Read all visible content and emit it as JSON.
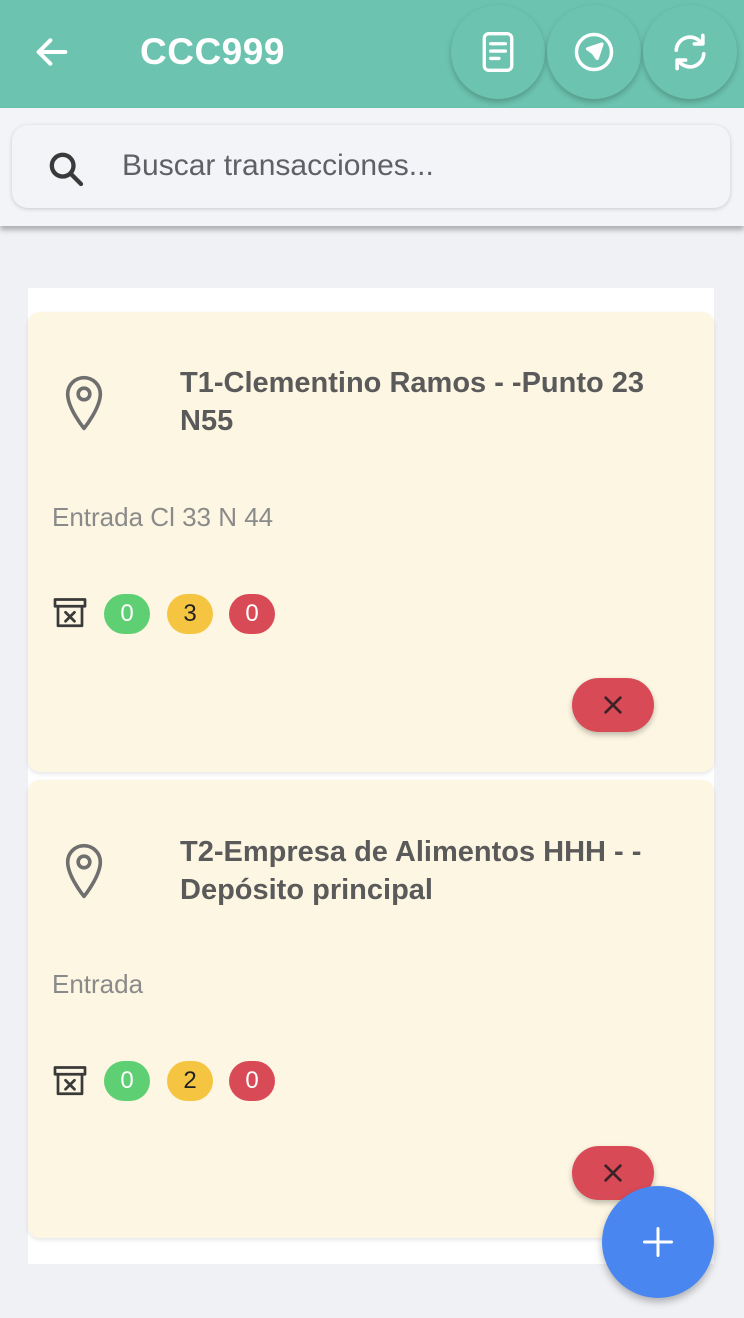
{
  "header": {
    "title": "CCC999",
    "back_icon": "arrow-left-icon",
    "actions": [
      {
        "icon": "document-icon"
      },
      {
        "icon": "navigation-icon"
      },
      {
        "icon": "sync-icon"
      }
    ],
    "color": "#6cc3b0"
  },
  "search": {
    "placeholder": "Buscar transacciones...",
    "value": "",
    "icon": "search-icon"
  },
  "transactions": [
    {
      "title": "T1-Clementino Ramos - -Punto 23 N55",
      "subtitle": "Entrada Cl 33 N 44",
      "counts": {
        "green": "0",
        "yellow": "3",
        "red": "0"
      }
    },
    {
      "title": "T2-Empresa de Alimentos HHH - -Depósito principal",
      "subtitle": "Entrada",
      "counts": {
        "green": "0",
        "yellow": "2",
        "red": "0"
      }
    }
  ],
  "fab": {
    "icon": "plus-icon",
    "color": "#4a86f0"
  },
  "colors": {
    "card_bg": "#fdf6e2",
    "badge_green": "#5ecf72",
    "badge_yellow": "#f5c542",
    "badge_red": "#d94a57"
  }
}
